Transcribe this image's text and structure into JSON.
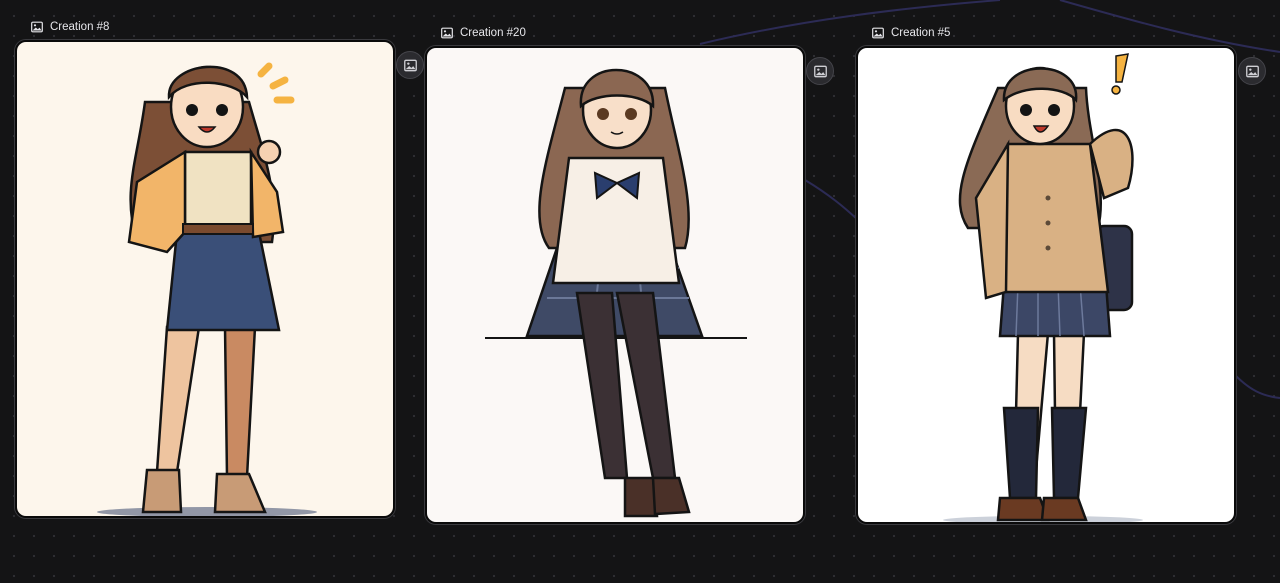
{
  "canvas": {
    "background": "#141415",
    "nodes": [
      {
        "label": "Creation #8",
        "icon": "image-icon",
        "output_handle_icon": "image-icon",
        "image": "anime girl in orange cardigan and denim skirt, waving, with yellow exclamation strokes",
        "bg": "#fdf6ec"
      },
      {
        "label": "Creation #20",
        "icon": "image-icon",
        "output_handle_icon": "image-icon",
        "image": "anime girl in white blouse with navy bow and plaid skirt, sitting on a ledge",
        "bg": "#fbf8f6"
      },
      {
        "label": "Creation #5",
        "icon": "image-icon",
        "output_handle_icon": "image-icon",
        "image": "anime girl in tan cardigan and plaid skirt with shoulder bag and yellow exclamation mark",
        "bg": "#ffffff"
      }
    ]
  }
}
